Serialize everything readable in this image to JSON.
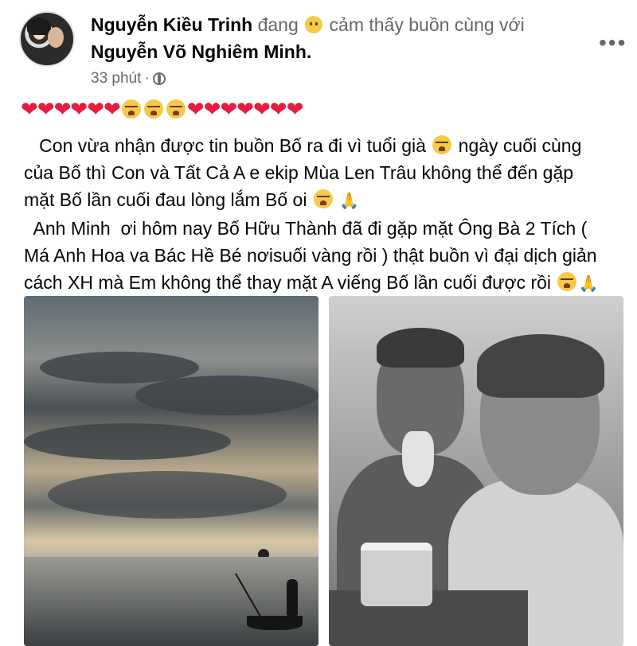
{
  "post": {
    "author": "Nguyễn Kiều Trinh",
    "feeling_prefix": "đang",
    "feeling_text": "cảm thấy buồn cùng với",
    "tagged_user": "Nguyễn Võ Nghiêm Minh",
    "tagged_suffix": ".",
    "time": "33 phút",
    "time_separator": "·",
    "more_label": "•••",
    "heart_glyph": "❤",
    "body": {
      "line1_a": "   Con vừa nhận được tin buồn Bố ra đi vì tuổi già ",
      "line1_b": " ngày cuối cùng",
      "line2": "của Bố thì Con và Tất Cả A e ekip Mùa Len Trâu không thể đến gặp",
      "line3": "mặt Bố lần cuối đau lòng lắm Bố oi ",
      "line4": "  Anh Minh  ơi hôm nay Bố Hữu Thành đã đi gặp mặt Ông Bà 2 Tích (",
      "line5": "Má Anh Hoa va Bác Hề Bé nơisuối vàng rồi ) thật buồn vì đại dịch giản",
      "line6": "cách XH mà Em không thể thay mặt A viếng Bố lần cuối được rồi "
    },
    "pray_glyph": "🙏"
  },
  "icons": {
    "avatar": "avatar-photo",
    "feeling": "sad-face-icon",
    "globe": "globe-icon",
    "heart": "red-heart-icon",
    "cry": "crying-face-icon",
    "pray": "folded-hands-icon"
  },
  "colors": {
    "name": "#050505",
    "meta": "#65676b",
    "heart": "#e41e3f",
    "emoji": "#f7c948"
  },
  "photos": [
    {
      "subject": "sunset over river with boatman silhouette"
    },
    {
      "subject": "black-and-white portrait of elderly man and woman"
    }
  ]
}
